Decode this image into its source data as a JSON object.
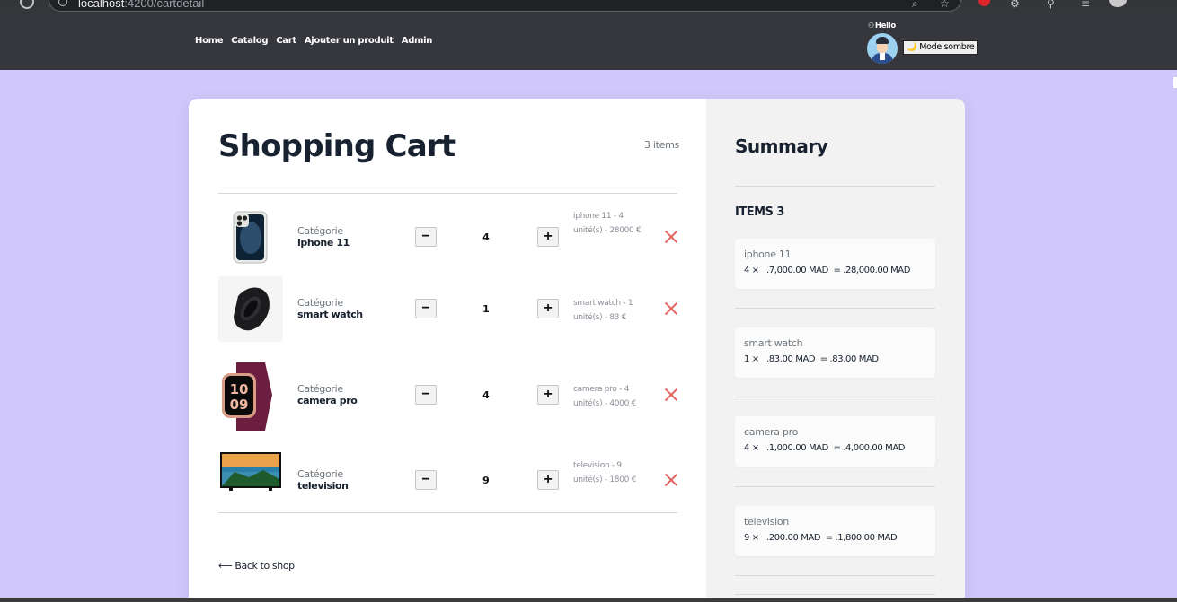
{
  "browser": {
    "url_host": "localhost",
    "url_path": ":4200/cartdetail"
  },
  "nav": {
    "links": [
      "Home",
      "Catalog",
      "Cart",
      "Ajouter un produit",
      "Admin"
    ],
    "greeting": "Hello",
    "mode_toggle": "🌙 Mode sombre"
  },
  "cart": {
    "title": "Shopping Cart",
    "count": "3 items",
    "category_label": "Catégorie",
    "items": [
      {
        "name": "iphone 11",
        "qty": "4",
        "detail": "iphone 11 - 4 unité(s) - 28000 €",
        "image": "iphone"
      },
      {
        "name": "smart watch",
        "qty": "1",
        "detail": "smart watch - 1 unité(s) - 83 €",
        "image": "fitness-band"
      },
      {
        "name": "camera pro",
        "qty": "4",
        "detail": "camera pro - 4 unité(s) - 4000 €",
        "image": "smartwatch"
      },
      {
        "name": "television",
        "qty": "9",
        "detail": "television - 9 unité(s) - 1800 €",
        "image": "tv"
      }
    ],
    "minus_glyph": "−",
    "plus_glyph": "+",
    "back_label": "Back to shop"
  },
  "summary": {
    "title": "Summary",
    "items_label": "ITEMS 3",
    "lines": [
      {
        "name": "iphone 11",
        "calc": "4 ×   .7,000.00 MAD  = .28,000.00 MAD"
      },
      {
        "name": "smart watch",
        "calc": "1 ×   .83.00 MAD  = .83.00 MAD"
      },
      {
        "name": "camera pro",
        "calc": "4 ×   .1,000.00 MAD  = .4,000.00 MAD"
      },
      {
        "name": "television",
        "calc": "9 ×   .200.00 MAD  = .1,800.00 MAD"
      }
    ]
  },
  "colors": {
    "page_bg": "#d0c8fb",
    "navbar_bg": "#35373d",
    "remove_red": "#e26161"
  }
}
